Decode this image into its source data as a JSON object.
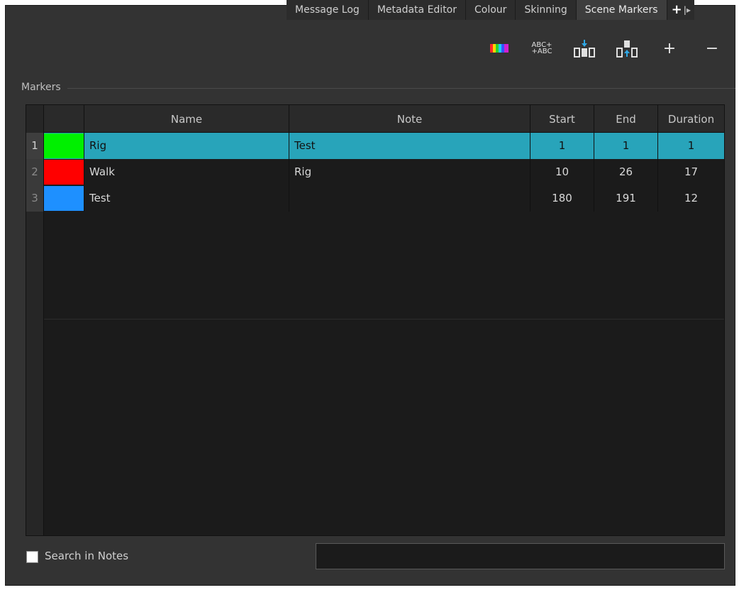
{
  "tabs": [
    {
      "label": "Message Log",
      "active": false
    },
    {
      "label": "Metadata Editor",
      "active": false
    },
    {
      "label": "Colour",
      "active": false
    },
    {
      "label": "Skinning",
      "active": false
    },
    {
      "label": "Scene Markers",
      "active": true
    }
  ],
  "toolbar": {
    "colour_icon": "colour-bars-icon",
    "rename_text_top": "ABC+",
    "rename_text_bottom": "+ABC",
    "insert_icon": "insert-marker-icon",
    "extract_icon": "extract-marker-icon",
    "add_label": "+",
    "remove_label": "−"
  },
  "group": {
    "label": "Markers"
  },
  "table": {
    "columns": [
      "Name",
      "Note",
      "Start",
      "End",
      "Duration"
    ],
    "rows": [
      {
        "index": "1",
        "color": "#00f000",
        "name": "Rig",
        "note": "Test",
        "start": "1",
        "end": "1",
        "duration": "1",
        "selected": true
      },
      {
        "index": "2",
        "color": "#ff0000",
        "name": "Walk",
        "note": "Rig",
        "start": "10",
        "end": "26",
        "duration": "17",
        "selected": false
      },
      {
        "index": "3",
        "color": "#1e90ff",
        "name": "Test",
        "note": "",
        "start": "180",
        "end": "191",
        "duration": "12",
        "selected": false
      }
    ]
  },
  "footer": {
    "search_label": "Search in Notes",
    "search_value": "",
    "search_checked": false
  },
  "colors": {
    "selection": "#28a4ba",
    "panel": "#333333",
    "table_bg": "#1b1b1b"
  }
}
